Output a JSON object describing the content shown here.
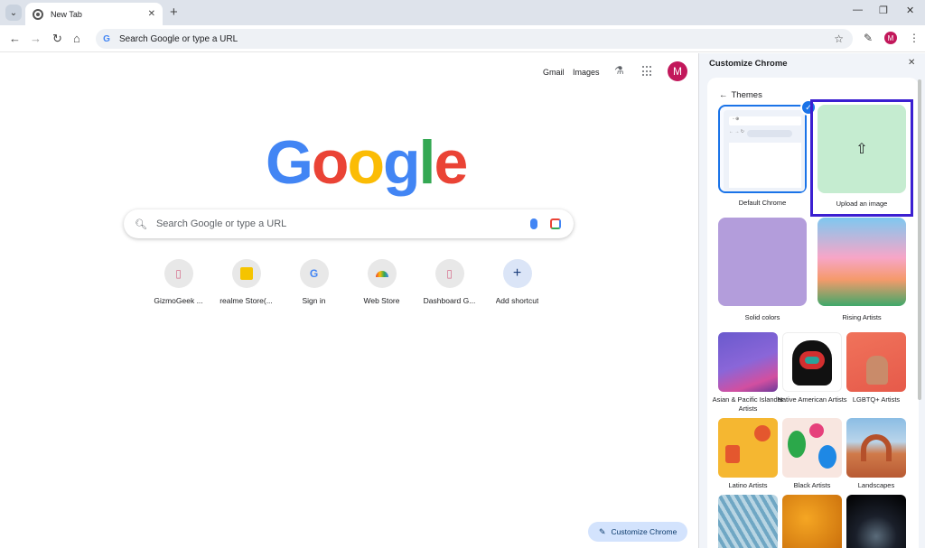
{
  "browser": {
    "tab_title": "New Tab",
    "new_tab_label": "+",
    "omnibox_placeholder": "Search Google or type a URL",
    "profile_initial": "M"
  },
  "ntp": {
    "gmail_label": "Gmail",
    "images_label": "Images",
    "profile_initial": "M",
    "logo_letters": [
      "G",
      "o",
      "o",
      "g",
      "l",
      "e"
    ],
    "search_placeholder": "Search Google or type a URL",
    "shortcuts": [
      {
        "label": "GizmoGeek ...",
        "icon": "doc-icon"
      },
      {
        "label": "realme Store(...",
        "icon": "realme-icon"
      },
      {
        "label": "Sign in",
        "icon": "google-icon"
      },
      {
        "label": "Web Store",
        "icon": "webstore-icon"
      },
      {
        "label": "Dashboard G...",
        "icon": "doc-icon"
      },
      {
        "label": "Add shortcut",
        "icon": "plus-icon"
      }
    ],
    "customize_button": "Customize Chrome"
  },
  "panel": {
    "title": "Customize Chrome",
    "back_label": "Themes",
    "themes": {
      "default_chrome": "Default Chrome",
      "upload_image": "Upload an image",
      "solid_colors": "Solid colors",
      "rising_artists": "Rising Artists",
      "asian_pacific": "Asian & Pacific Islander Artists",
      "native_american": "Native American Artists",
      "lgbtq": "LGBTQ+ Artists",
      "latino": "Latino Artists",
      "black_artists": "Black Artists",
      "landscapes": "Landscapes"
    }
  },
  "colors": {
    "google_blue": "#4285f4",
    "google_red": "#ea4335",
    "google_yellow": "#fbbc05",
    "google_green": "#34a853",
    "highlight": "#3b1fd1",
    "profile": "#c2185b"
  }
}
